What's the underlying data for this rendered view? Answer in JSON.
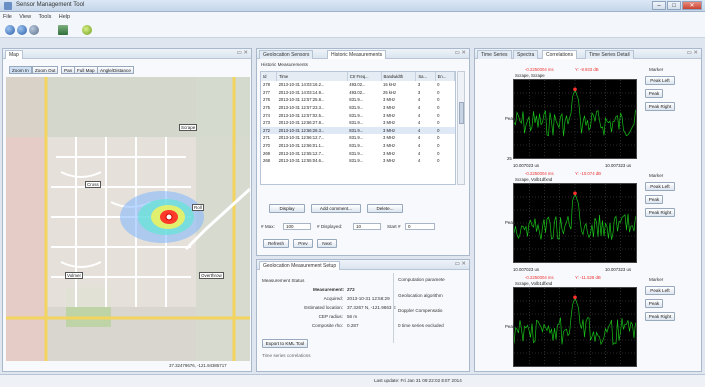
{
  "window": {
    "title": "Sensor Management Tool",
    "controls": [
      "–",
      "□",
      "✕"
    ]
  },
  "menu": [
    "File",
    "View",
    "Tools",
    "Help"
  ],
  "map_panel": {
    "tab": "Map",
    "buttons": [
      "Zoom In",
      "Zoom Out",
      "Pan",
      "Full Map",
      "Angle/Distance"
    ],
    "sensors": [
      "Scrape",
      "Cross",
      "Roll",
      "Volmer",
      "Overthrow"
    ],
    "coordinates": "37.32479676, -121.94385717"
  },
  "history_panel": {
    "tabs": [
      "Geolocation Sensors",
      "Historic Measurements"
    ],
    "section_title": "Historic Measurements",
    "columns": [
      "Id",
      "Time",
      "Ctr Freq...",
      "Bandwidth",
      "Sa...",
      "En..."
    ],
    "rows": [
      [
        "278",
        "2013-10-31 14:03:16.2...",
        "493.02...",
        "15 kHz",
        "3",
        "0"
      ],
      [
        "277",
        "2013-10-31 14:03:14.9...",
        "493.02...",
        "25 kHz",
        "3",
        "0"
      ],
      [
        "276",
        "2013-10-31 12:57:25.8...",
        "831.9...",
        "3 MHz",
        "4",
        "0"
      ],
      [
        "275",
        "2013-10-31 12:57:23.3...",
        "831.9...",
        "3 MHz",
        "4",
        "0"
      ],
      [
        "274",
        "2013-10-31 12:57:02.5...",
        "831.9...",
        "3 MHz",
        "4",
        "0"
      ],
      [
        "273",
        "2013-10-31 12:56:27.8...",
        "831.9...",
        "3 MHz",
        "4",
        "0"
      ],
      [
        "272",
        "2013-10-31 12:56:26.3...",
        "831.9...",
        "3 MHz",
        "4",
        "0"
      ],
      [
        "271",
        "2013-10-31 12:56:12.7...",
        "831.9...",
        "3 MHz",
        "4",
        "0"
      ],
      [
        "270",
        "2013-10-31 12:56:01.1...",
        "831.9...",
        "3 MHz",
        "4",
        "0"
      ],
      [
        "269",
        "2013-10-31 12:55:12.7...",
        "831.9...",
        "3 MHz",
        "4",
        "0"
      ],
      [
        "268",
        "2013-10-31 12:55:04.6...",
        "831.9...",
        "3 MHz",
        "4",
        "0"
      ]
    ],
    "actions": [
      "Display",
      "Add comment...",
      "Delete..."
    ],
    "max_label": "# Max:",
    "max_value": "100",
    "displayed_label": "# Displayed:",
    "displayed_value": "10",
    "start_label": "Start #",
    "start_value": "0",
    "nav_buttons": [
      "Refresh",
      "Prev",
      "Next"
    ]
  },
  "geo_setup": {
    "tab": "Geolocation Measurement Setup",
    "status_label": "Measurement Status",
    "fields": [
      {
        "label": "Measurement:",
        "value": "272"
      },
      {
        "label": "Acquired:",
        "value": "2013-10-31 12:56:29"
      },
      {
        "label": "Estimated location:",
        "value": "37.3267 N, -121.9663 E"
      },
      {
        "label": "CEP radius:",
        "value": "56 m"
      },
      {
        "label": "Composite rho:",
        "value": "0.287"
      }
    ],
    "export_button": "Export to KML Tool",
    "truncated_row": "Time series correlations",
    "params_header": "Computation paramete",
    "params": [
      "Geolocation algorithm",
      "Doppler Compensatio",
      "0 time series excluded"
    ]
  },
  "right_panel": {
    "tabs": [
      "Time Series",
      "Spectra",
      "Correlations",
      "Time Series Detail"
    ],
    "plots": [
      {
        "marker_left": "-0.2250004 ms",
        "marker_right": "Y: -8.933 dB",
        "subtitle": "Scrape, Scrape",
        "x_start": "10.007023 us",
        "x_end": "10.007323 us"
      },
      {
        "marker_left": "-0.2250004 ms",
        "marker_right": "Y: -10.074 dB",
        "subtitle": "Scrape, Volb1dfxnd",
        "x_start": "10.007023 us",
        "x_end": "10.007323 us"
      },
      {
        "marker_left": "-0.2250004 ms",
        "marker_right": "Y: -11.528 dB",
        "subtitle": "Scrape, Volb1dfxnd",
        "x_start": "",
        "x_end": ""
      }
    ],
    "y_label": "Peak",
    "y_bottom": "25",
    "side_buttons": [
      "Peak Left",
      "Peak",
      "Peak Right"
    ],
    "marker_label": "Marker"
  },
  "status": {
    "text": "Last update: Fri Jan 31 09:22:02 EST 2014"
  },
  "colors": {
    "accent": "#3a6fb3",
    "plot_bg": "#000000",
    "trace": "#19c21a",
    "marker": "#ff3030"
  }
}
